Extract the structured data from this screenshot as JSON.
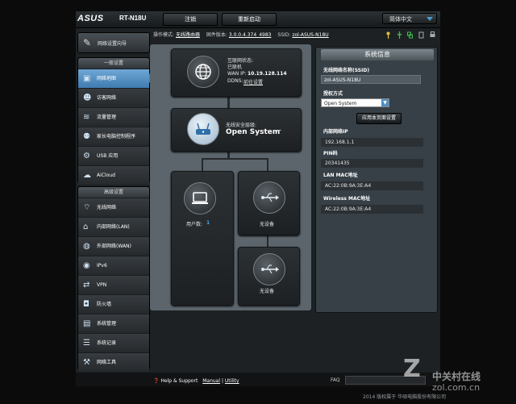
{
  "header": {
    "brand": "ASUS",
    "model": "RT-N18U",
    "logout_label": "注销",
    "reboot_label": "重新启动",
    "language_label": "简体中文"
  },
  "statusbar": {
    "mode_label": "操作模式:",
    "mode_value": "无线路由器",
    "firmware_label": "固件版本:",
    "firmware_value": "3.0.0.4.374_4983",
    "ssid_label": "SSID:",
    "ssid_value": "zol-ASUS-N18U"
  },
  "sidebar": {
    "wizard_label": "网络设置向导",
    "general_title": "一般设置",
    "general_items": [
      {
        "label": "网络地图",
        "icon": "network-map-icon"
      },
      {
        "label": "访客网络",
        "icon": "guest-network-icon"
      },
      {
        "label": "流量管理",
        "icon": "traffic-manager-icon"
      },
      {
        "label": "家长电脑控制程序",
        "icon": "parental-control-icon"
      },
      {
        "label": "USB 应用",
        "icon": "usb-app-icon"
      },
      {
        "label": "AiCloud",
        "icon": "aicloud-icon"
      }
    ],
    "advanced_title": "高级设置",
    "advanced_items": [
      {
        "label": "无线网络",
        "icon": "wireless-icon"
      },
      {
        "label": "内部网络(LAN)",
        "icon": "lan-icon"
      },
      {
        "label": "外部网络(WAN)",
        "icon": "wan-icon"
      },
      {
        "label": "IPv6",
        "icon": "ipv6-icon"
      },
      {
        "label": "VPN",
        "icon": "vpn-icon"
      },
      {
        "label": "防火墙",
        "icon": "firewall-icon"
      },
      {
        "label": "系统管理",
        "icon": "administration-icon"
      },
      {
        "label": "系统记录",
        "icon": "system-log-icon"
      },
      {
        "label": "网络工具",
        "icon": "network-tools-icon"
      }
    ]
  },
  "map": {
    "internet_status_label": "互联网状态:",
    "internet_status": "已联机",
    "wan_ip_label": "WAN IP:",
    "wan_ip": "10.19.128.114",
    "ddns_label": "DDNS:",
    "ddns_value": "前往设置",
    "security_label": "无线安全层级:",
    "security_value": "Open System",
    "clients_label": "用户数:",
    "clients_value": "1",
    "usb1_label": "无设备",
    "usb2_label": "无设备"
  },
  "sysinfo": {
    "title": "系统信息",
    "ssid_label": "无线网络名称(SSID)",
    "ssid_value": "zol-ASUS-N18U",
    "auth_label": "授权方式",
    "auth_value": "Open System",
    "apply_label": "应用本页面设置",
    "lan_ip_label": "内部网络IP",
    "lan_ip_value": "192.168.1.1",
    "pin_label": "PIN码",
    "pin_value": "20341435",
    "lan_mac_label": "LAN MAC地址",
    "lan_mac_value": "AC:22:0B:9A:3E:A4",
    "wl_mac_label": "Wireless MAC地址",
    "wl_mac_value": "AC:22:0B:9A:3E:A4"
  },
  "footer": {
    "help_label": "Help & Support",
    "manual_label": "Manual",
    "utility_label": "Utility",
    "faq_label": "FAQ",
    "copyright": "2014 版权属于 华硕电脑股份有限公司"
  },
  "watermark": {
    "logo": "Z",
    "text": "中关村在线",
    "url": "zol.com.cn"
  },
  "colors": {
    "accent": "#3f7bb0",
    "panel": "#5b656b",
    "background": "#0b0b0b"
  }
}
